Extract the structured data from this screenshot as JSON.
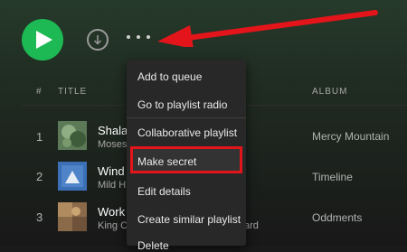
{
  "colors": {
    "accent": "#1db954",
    "highlight": "#e3151b",
    "arrow": "#e3151b"
  },
  "controls": {
    "play_icon": "play-icon",
    "download_icon": "download-icon",
    "more_icon": "more-horizontal-icon"
  },
  "table": {
    "headers": {
      "num": "#",
      "title": "TITLE",
      "album": "ALBUM"
    },
    "rows": [
      {
        "num": "1",
        "title": "Shala",
        "artist": "Moses",
        "album": "Mercy Mountain"
      },
      {
        "num": "2",
        "title": "Wind",
        "artist": "Mild H",
        "album": "Timeline"
      },
      {
        "num": "3",
        "title": "Work",
        "artist": "King C",
        "album": "Oddments"
      }
    ],
    "partial_text": "ard"
  },
  "menu": {
    "items": [
      "Add to queue",
      "Go to playlist radio",
      "Collaborative playlist",
      "Make secret",
      "Edit details",
      "Create similar playlist",
      "Delete"
    ]
  }
}
